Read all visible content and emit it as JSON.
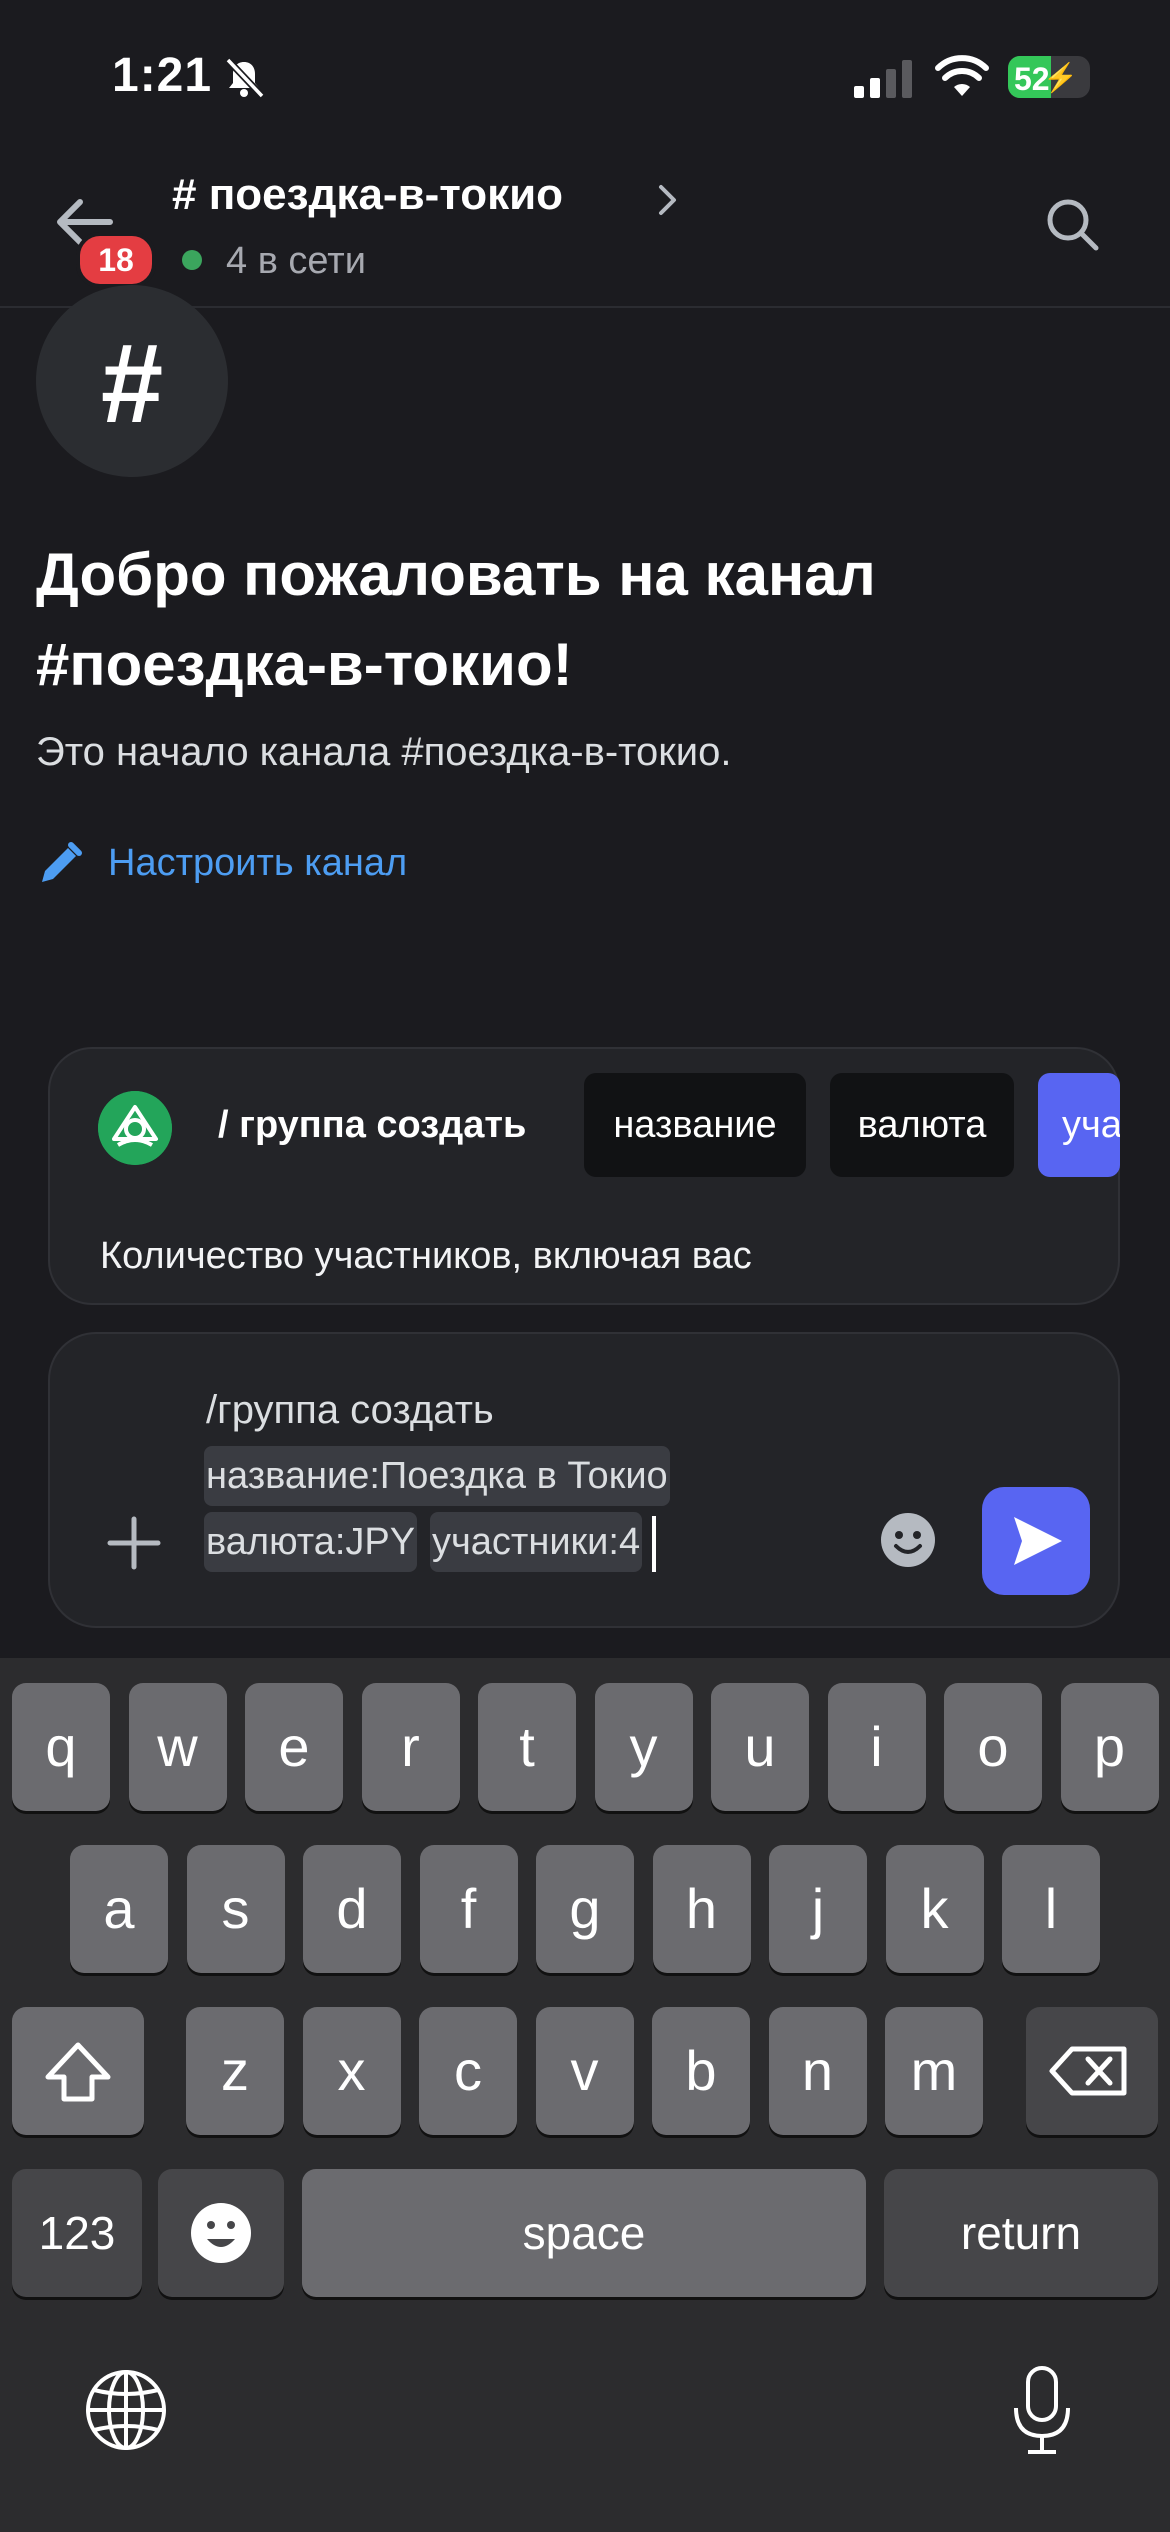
{
  "status": {
    "time": "1:21",
    "battery": "52",
    "battery_level": 0.52
  },
  "header": {
    "unread_count": "18",
    "channel_title": "# поездка-в-токио",
    "online": "4 в сети"
  },
  "welcome": {
    "hash": "#",
    "title": "Добро пожаловать на канал #поездка-в-токио!",
    "subtitle": "Это начало канала #поездка-в-токио.",
    "configure_link": "Настроить канал"
  },
  "command": {
    "name": "/ группа создать",
    "options": [
      "название",
      "валюта",
      "участники"
    ],
    "description": "Количество участников, включая вас"
  },
  "input": {
    "line1": "/группа создать",
    "name_param": "название:Поездка в Токио",
    "currency_param": "валюта:JPY",
    "members_param": "участники:4"
  },
  "keyboard": {
    "row1": [
      "q",
      "w",
      "e",
      "r",
      "t",
      "y",
      "u",
      "i",
      "o",
      "p"
    ],
    "row2": [
      "a",
      "s",
      "d",
      "f",
      "g",
      "h",
      "j",
      "k",
      "l"
    ],
    "row3": [
      "z",
      "x",
      "c",
      "v",
      "b",
      "n",
      "m"
    ],
    "numbers": "123",
    "space": "space",
    "return": "return"
  },
  "colors": {
    "background": "#1b1b1f",
    "accent": "#5865f2",
    "link": "#4d9df2",
    "online": "#3ba55d",
    "badge": "#e43d42"
  },
  "icons": [
    "bell-slash-icon",
    "signal-icon",
    "wifi-icon",
    "battery-icon",
    "back-arrow-icon",
    "chevron-right-icon",
    "search-icon",
    "pencil-icon",
    "app-icon",
    "plus-icon",
    "emoji-icon",
    "send-icon",
    "shift-icon",
    "backspace-icon",
    "emoji-key-icon",
    "globe-icon",
    "mic-icon"
  ]
}
